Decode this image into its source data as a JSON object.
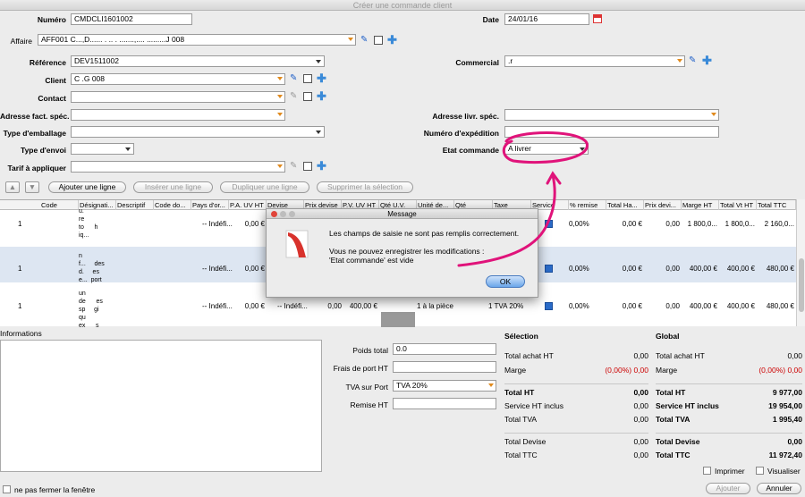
{
  "window": {
    "title": "Créer une commande client"
  },
  "form": {
    "numero_label": "Numéro",
    "numero": "CMDCLI1601002",
    "date_label": "Date",
    "date": "24/01/16",
    "affaire_label": "Affaire",
    "affaire": "AFF001  C...,D...... . .. . .......,.... .........J 008",
    "reference_label": "Référence",
    "reference": "DEV1511002",
    "commercial_label": "Commercial",
    "commercial": "                   .r",
    "client_label": "Client",
    "client": "C                                               .G 008",
    "contact_label": "Contact",
    "adresse_fact_label": "Adresse fact. spéc.",
    "adresse_livr_label": "Adresse livr. spéc.",
    "emballage_label": "Type d'emballage",
    "expedition_label": "Numéro d'expédition",
    "envoi_label": "Type d'envoi",
    "etat_label": "Etat commande",
    "etat": "A livrer",
    "tarif_label": "Tarif à appliquer"
  },
  "toolbar": {
    "add": "Ajouter une ligne",
    "insert": "Insérer une ligne",
    "dup": "Dupliquer une ligne",
    "del": "Supprimer la sélection"
  },
  "table": {
    "headers": [
      "Code",
      "Désignati...",
      "Descriptif",
      "Code do...",
      "Pays d'or...",
      "P.A. UV HT",
      "Devise",
      "Prix devise",
      "P.V. UV HT",
      "Qté U.V.",
      "Unité de...",
      "Qté",
      "Taxe",
      "Service",
      "% remise",
      "Total Ha...",
      "Prix devi...",
      "Marge HT",
      "Total Vt HT",
      "Total TTC"
    ],
    "rows": [
      {
        "n": "1",
        "design": "u.\nre\nto      h\niq...",
        "pays": "-- Indéfi...",
        "pa": "0,00 €",
        "remise": "0,00%",
        "tha": "0,00 €",
        "pdev": "0,00",
        "marge": "1 800,0...",
        "tvt": "1 800,0...",
        "ttc": "2 160,0..."
      },
      {
        "n": "1",
        "design": "n\nf...     des\nd.     es\ne...  port",
        "pays": "-- Indéfi...",
        "pa": "0,00 €",
        "remise": "0,00%",
        "tha": "0,00 €",
        "pdev": "0,00",
        "marge": "400,00 €",
        "tvt": "400,00 €",
        "ttc": "480,00 €"
      },
      {
        "n": "1",
        "design": "un\nde      es\nsp     gi\nqu\nex      s",
        "pays": "-- Indéfi...",
        "pa": "0,00 €",
        "devise": "-- Indéfi...",
        "prixdev": "0,00",
        "pvuv": "400,00 €",
        "unite": "1 à la pièce",
        "taxe": "1 TVA 20%",
        "remise": "0,00%",
        "tha": "0,00 €",
        "pdev": "0,00",
        "marge": "400,00 €",
        "tvt": "400,00 €",
        "ttc": "480,00 €"
      }
    ]
  },
  "dialog": {
    "title": "Message",
    "line1": "Les champs de saisie ne sont pas remplis correctement.",
    "line2": "Vous ne pouvez enregistrer les modifications :",
    "line3": "'Etat commande' est vide",
    "ok": "OK"
  },
  "bottom": {
    "informations": "Informations",
    "poids_label": "Poids total",
    "poids": "0.0",
    "frais_label": "Frais de port HT",
    "tva_label": "TVA sur Port",
    "tva": "TVA 20%",
    "remise_label": "Remise HT"
  },
  "selection": {
    "title": "Sélection",
    "rows": [
      {
        "l": "Total achat HT",
        "v": "0,00",
        "b": false
      },
      {
        "l": "Marge",
        "v": "(0,00%) 0,00",
        "b": false,
        "red": true
      },
      {
        "l": "Total HT",
        "v": "0,00",
        "b": true
      },
      {
        "l": "Service HT inclus",
        "v": "0,00",
        "b": false
      },
      {
        "l": "Total TVA",
        "v": "0,00",
        "b": false
      },
      {
        "l": "Total Devise",
        "v": "0,00",
        "b": false
      },
      {
        "l": "Total TTC",
        "v": "0,00",
        "b": false
      }
    ]
  },
  "global": {
    "title": "Global",
    "rows": [
      {
        "l": "Total achat HT",
        "v": "0,00",
        "b": false
      },
      {
        "l": "Marge",
        "v": "(0,00%) 0,00",
        "b": false,
        "red": true
      },
      {
        "l": "Total HT",
        "v": "9 977,00",
        "b": true
      },
      {
        "l": "Service HT inclus",
        "v": "19 954,00",
        "b": true
      },
      {
        "l": "Total TVA",
        "v": "1 995,40",
        "b": true
      },
      {
        "l": "Total Devise",
        "v": "0,00",
        "b": true
      },
      {
        "l": "Total TTC",
        "v": "11 972,40",
        "b": true
      }
    ]
  },
  "footer": {
    "imprimer": "Imprimer",
    "visualiser": "Visualiser",
    "fermer": "ne pas fermer la fenêtre",
    "ajouter": "Ajouter",
    "annuler": "Annuler"
  },
  "colors": {
    "annotation": "#e0137a",
    "accent": "#3a8ad8"
  }
}
